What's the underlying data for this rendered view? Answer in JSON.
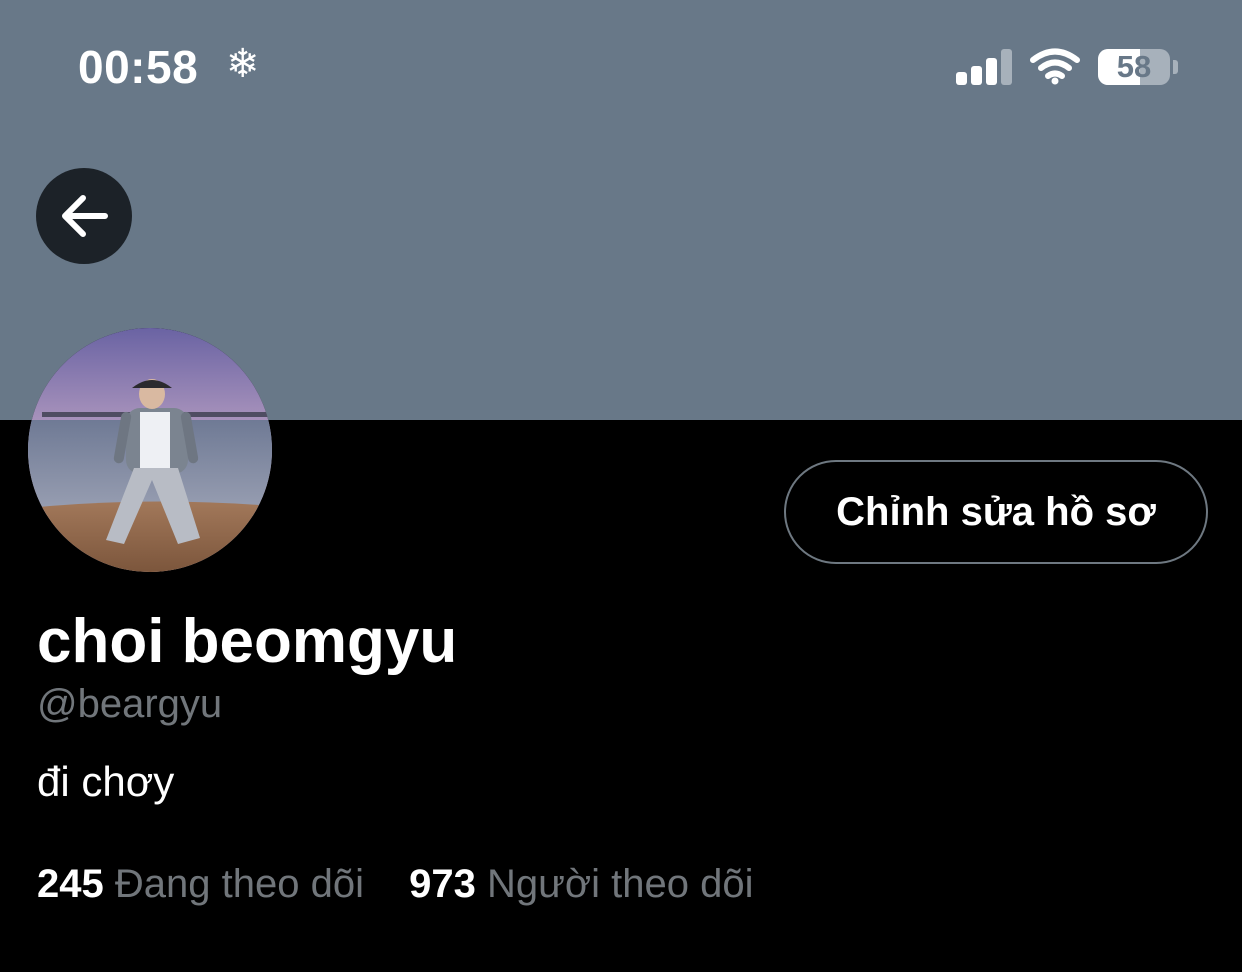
{
  "status_bar": {
    "time": "00:58",
    "weather_icon": "snowflake-icon",
    "battery_level": "58"
  },
  "profile": {
    "display_name": "choi beomgyu",
    "handle": "@beargyu",
    "bio": "đi chơy",
    "edit_button_label": "Chỉnh sửa hồ sơ",
    "following_count": "245",
    "following_label": "Đang theo dõi",
    "followers_count": "973",
    "followers_label": "Người theo dõi"
  },
  "colors": {
    "banner": "#687888",
    "background": "#000000",
    "secondary_text": "#71767b",
    "button_border": "#6e7881"
  }
}
